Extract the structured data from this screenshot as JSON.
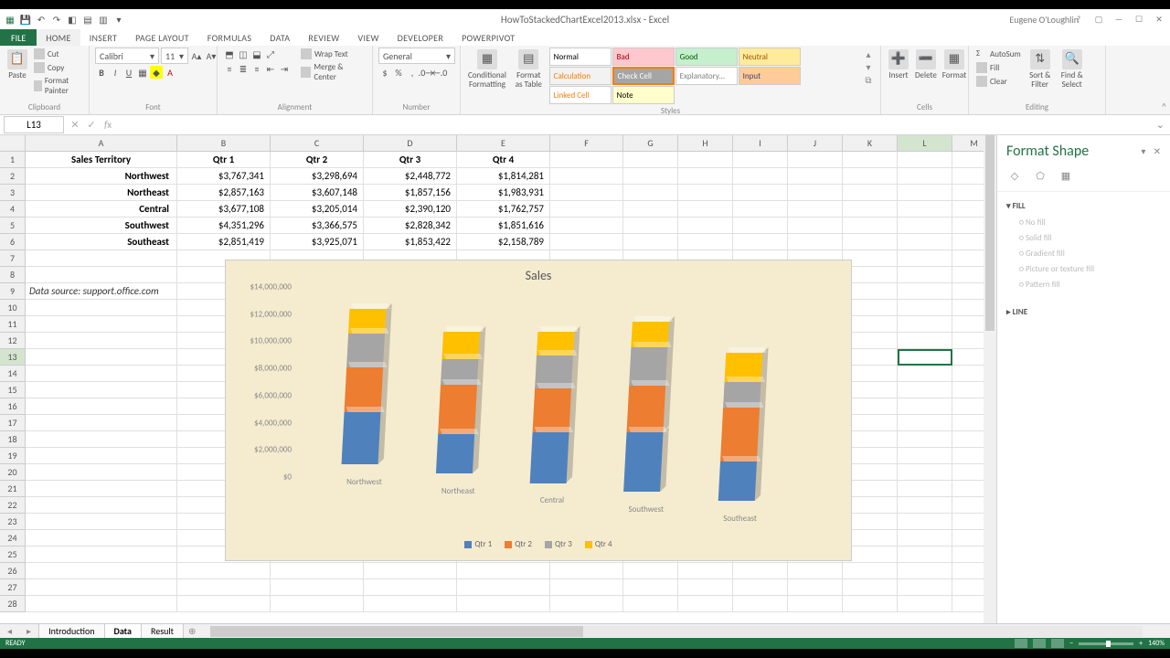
{
  "title": "HowToStackedChartExcel2013.xlsx - Excel",
  "user": "Eugene O'Loughlin",
  "tabs": [
    "HOME",
    "INSERT",
    "PAGE LAYOUT",
    "FORMULAS",
    "DATA",
    "REVIEW",
    "VIEW",
    "DEVELOPER",
    "POWERPIVOT"
  ],
  "file_tab": "FILE",
  "ribbon": {
    "clipboard": {
      "label": "Clipboard",
      "paste": "Paste",
      "cut": "Cut",
      "copy": "Copy",
      "fmt": "Format Painter"
    },
    "font": {
      "label": "Font",
      "name": "Calibri",
      "size": "11"
    },
    "alignment": {
      "label": "Alignment",
      "wrap": "Wrap Text",
      "merge": "Merge & Center"
    },
    "number": {
      "label": "Number",
      "format": "General"
    },
    "styles": {
      "label": "Styles",
      "cond": "Conditional Formatting",
      "fmt_table": "Format as Table",
      "cells": [
        {
          "t": "Normal",
          "bg": "#fff",
          "c": "#000"
        },
        {
          "t": "Bad",
          "bg": "#ffc7ce",
          "c": "#9c0006"
        },
        {
          "t": "Good",
          "bg": "#c6efce",
          "c": "#006100"
        },
        {
          "t": "Neutral",
          "bg": "#ffeb9c",
          "c": "#9c5700"
        },
        {
          "t": "Calculation",
          "bg": "#f2f2f2",
          "c": "#fa7d00"
        },
        {
          "t": "Check Cell",
          "bg": "#a5a5a5",
          "c": "#fff"
        },
        {
          "t": "Explanatory...",
          "bg": "#fff",
          "c": "#7f7f7f"
        },
        {
          "t": "Input",
          "bg": "#ffcc99",
          "c": "#3f3f76"
        },
        {
          "t": "Linked Cell",
          "bg": "#fff",
          "c": "#fa7d00"
        },
        {
          "t": "Note",
          "bg": "#ffffcc",
          "c": "#000"
        }
      ]
    },
    "cells": {
      "label": "Cells",
      "insert": "Insert",
      "delete": "Delete",
      "format": "Format"
    },
    "editing": {
      "label": "Editing",
      "sum": "AutoSum",
      "fill": "Fill",
      "clear": "Clear",
      "sort": "Sort & Filter",
      "find": "Find & Select"
    }
  },
  "namebox": "L13",
  "columns": [
    {
      "l": "A",
      "w": 166
    },
    {
      "l": "B",
      "w": 102
    },
    {
      "l": "C",
      "w": 102
    },
    {
      "l": "D",
      "w": 102
    },
    {
      "l": "E",
      "w": 102
    },
    {
      "l": "F",
      "w": 80
    },
    {
      "l": "G",
      "w": 60
    },
    {
      "l": "H",
      "w": 60
    },
    {
      "l": "I",
      "w": 60
    },
    {
      "l": "J",
      "w": 60
    },
    {
      "l": "K",
      "w": 60
    },
    {
      "l": "L",
      "w": 60
    },
    {
      "l": "M",
      "w": 48
    }
  ],
  "table": {
    "headers": [
      "Sales Territory",
      "Qtr 1",
      "Qtr 2",
      "Qtr 3",
      "Qtr 4"
    ],
    "rows": [
      {
        "label": "Northwest",
        "v": [
          "$3,767,341",
          "$3,298,694",
          "$2,448,772",
          "$1,814,281"
        ]
      },
      {
        "label": "Northeast",
        "v": [
          "$2,857,163",
          "$3,607,148",
          "$1,857,156",
          "$1,983,931"
        ]
      },
      {
        "label": "Central",
        "v": [
          "$3,677,108",
          "$3,205,014",
          "$2,390,120",
          "$1,762,757"
        ]
      },
      {
        "label": "Southwest",
        "v": [
          "$4,351,296",
          "$3,366,575",
          "$2,828,342",
          "$1,851,616"
        ]
      },
      {
        "label": "Southeast",
        "v": [
          "$2,851,419",
          "$3,925,071",
          "$1,853,422",
          "$2,158,789"
        ]
      }
    ],
    "source_note": "Data source: support.office.com"
  },
  "chart_data": {
    "type": "bar",
    "stacked": true,
    "title": "Sales",
    "categories": [
      "Northwest",
      "Northeast",
      "Central",
      "Southwest",
      "Southeast"
    ],
    "series": [
      {
        "name": "Qtr 1",
        "color": "#4f81bd",
        "values": [
          3767341,
          2857163,
          3677108,
          4351296,
          2851419
        ]
      },
      {
        "name": "Qtr 2",
        "color": "#ed7d31",
        "values": [
          3298694,
          3607148,
          3205014,
          3366575,
          3925071
        ]
      },
      {
        "name": "Qtr 3",
        "color": "#a5a5a5",
        "values": [
          2448772,
          1857156,
          2390120,
          2828342,
          1853422
        ]
      },
      {
        "name": "Qtr 4",
        "color": "#ffc000",
        "values": [
          1814281,
          1983931,
          1762757,
          1851616,
          2158789
        ]
      }
    ],
    "ylabel": "",
    "xlabel": "",
    "ylim": [
      0,
      14000000
    ],
    "yticks": [
      "$0",
      "$2,000,000",
      "$4,000,000",
      "$6,000,000",
      "$8,000,000",
      "$10,000,000",
      "$12,000,000",
      "$14,000,000"
    ]
  },
  "pane": {
    "title": "Format Shape",
    "fill": "FILL",
    "fill_opts": [
      "No fill",
      "Solid fill",
      "Gradient fill",
      "Picture or texture fill",
      "Pattern fill"
    ],
    "line": "LINE"
  },
  "sheet_tabs": [
    "Introduction",
    "Data",
    "Result"
  ],
  "active_sheet": 1,
  "status": {
    "ready": "READY",
    "zoom": "140%"
  }
}
